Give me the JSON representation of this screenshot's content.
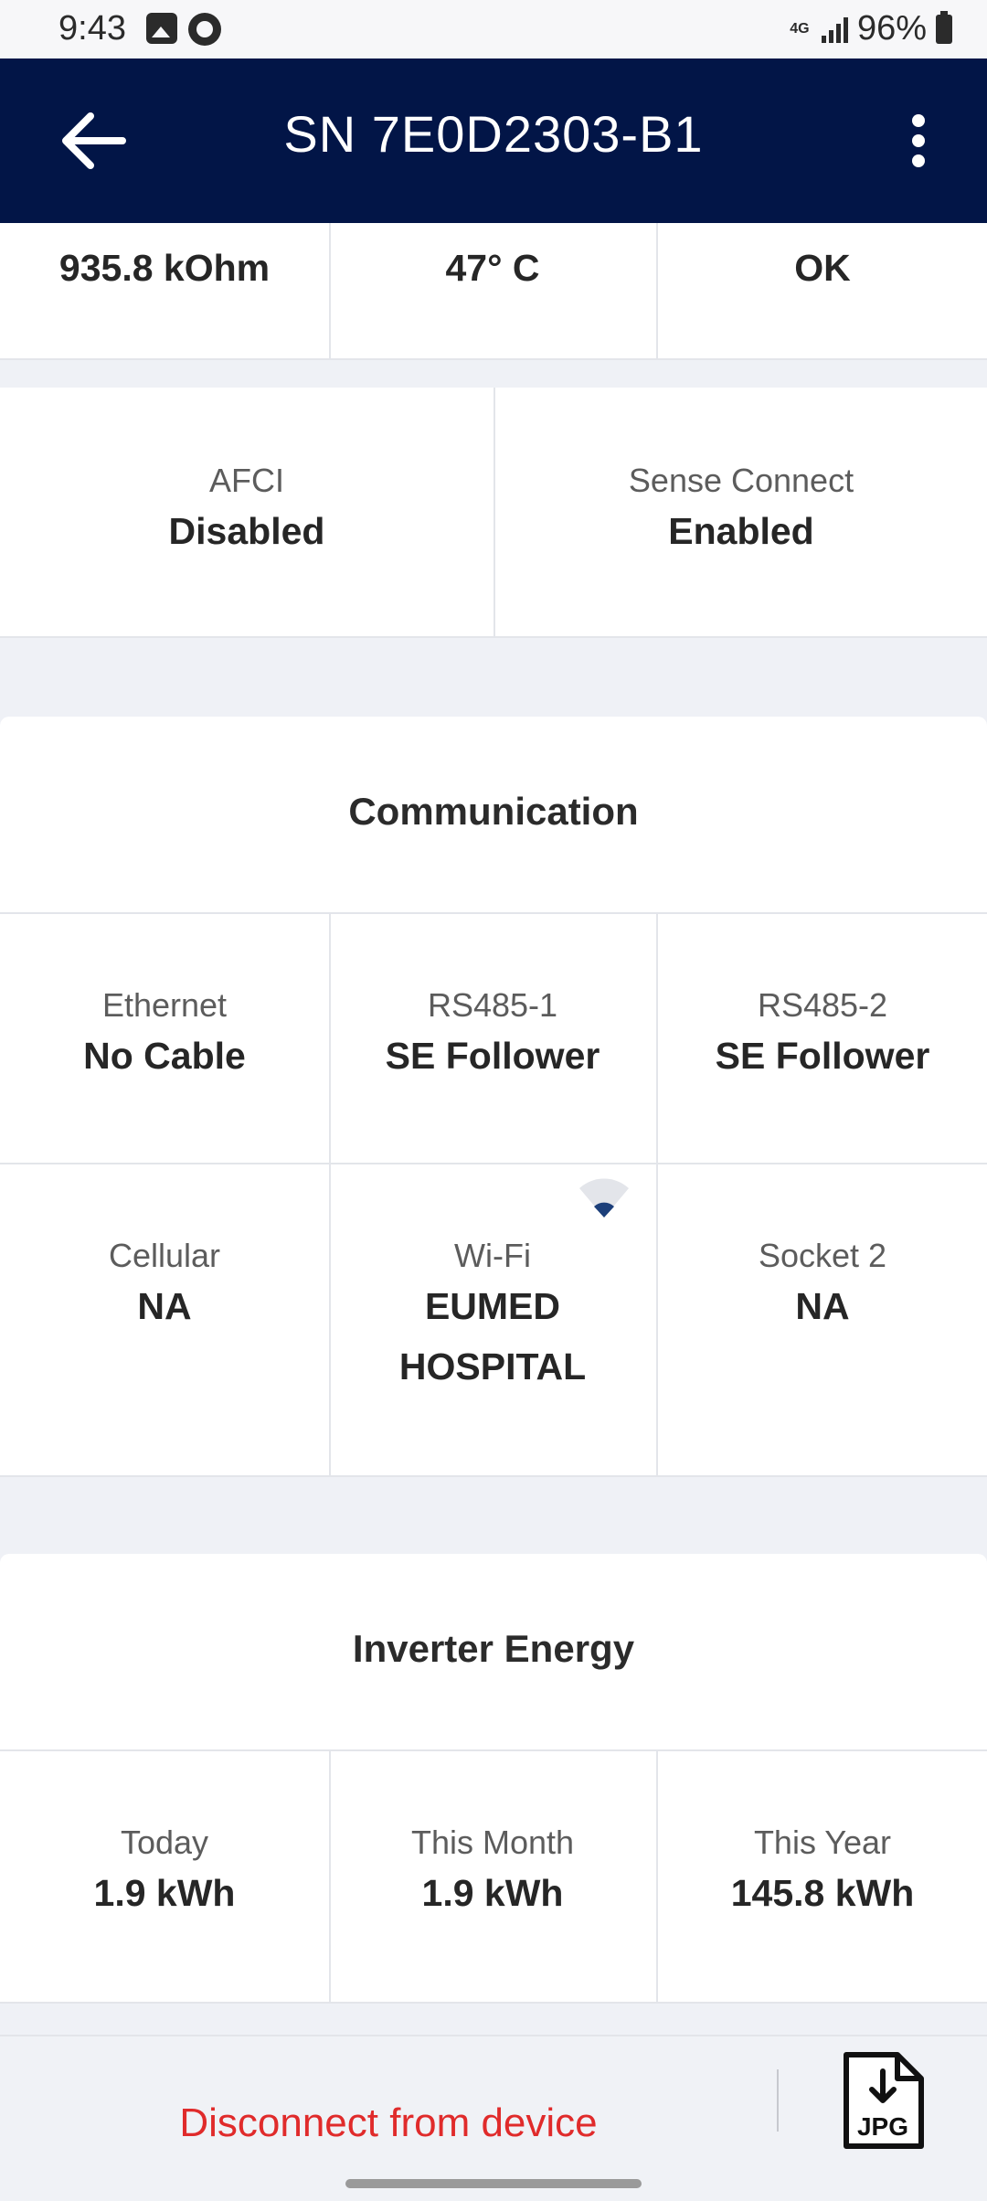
{
  "status_bar": {
    "time": "9:43",
    "network": "4G",
    "battery": "96%"
  },
  "header": {
    "title": "SN 7E0D2303-B1"
  },
  "top_row": [
    {
      "value": "935.8 kOhm"
    },
    {
      "value": "47° C"
    },
    {
      "value": "OK"
    }
  ],
  "safety_row": [
    {
      "label": "AFCI",
      "value": "Disabled"
    },
    {
      "label": "Sense Connect",
      "value": "Enabled"
    }
  ],
  "communication": {
    "title": "Communication",
    "items": [
      {
        "label": "Ethernet",
        "value": "No Cable"
      },
      {
        "label": "RS485-1",
        "value": "SE Follower"
      },
      {
        "label": "RS485-2",
        "value": "SE Follower"
      },
      {
        "label": "Cellular",
        "value": "NA"
      },
      {
        "label": "Wi-Fi",
        "value": "EUMED",
        "value2": "HOSPITAL"
      },
      {
        "label": "Socket 2",
        "value": "NA"
      }
    ]
  },
  "inverter_energy": {
    "title": "Inverter Energy",
    "items": [
      {
        "label": "Today",
        "value": "1.9 kWh"
      },
      {
        "label": "This Month",
        "value": "1.9 kWh"
      },
      {
        "label": "This Year",
        "value": "145.8 kWh"
      }
    ]
  },
  "bottom_bar": {
    "disconnect_label": "Disconnect from device",
    "export_label": "JPG"
  },
  "colors": {
    "header_bg": "#021547",
    "danger": "#e02b2b",
    "page_bg": "#eff1f6"
  },
  "icons": [
    "arrow-left-icon",
    "more-vert-icon",
    "wifi-icon",
    "jpg-download-icon"
  ]
}
